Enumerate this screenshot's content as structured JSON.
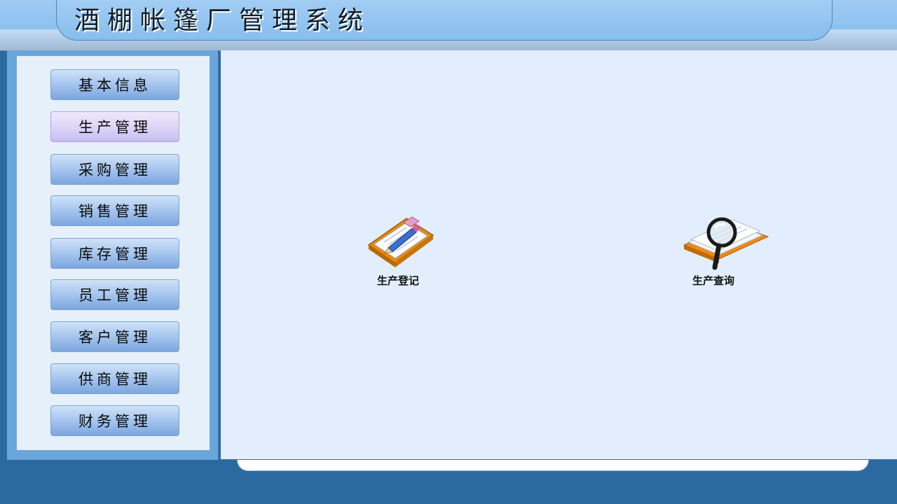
{
  "app": {
    "title": "酒棚帐篷厂管理系统"
  },
  "sidebar": {
    "active_index": 1,
    "items": [
      {
        "label": "基本信息"
      },
      {
        "label": "生产管理"
      },
      {
        "label": "采购管理"
      },
      {
        "label": "销售管理"
      },
      {
        "label": "库存管理"
      },
      {
        "label": "员工管理"
      },
      {
        "label": "客户管理"
      },
      {
        "label": "供商管理"
      },
      {
        "label": "财务管理"
      }
    ]
  },
  "main": {
    "features": [
      {
        "label": "生产登记",
        "icon": "clipboard-pen-icon"
      },
      {
        "label": "生产查询",
        "icon": "magnifier-document-icon"
      }
    ]
  },
  "colors": {
    "header_blue": "#8fc3f0",
    "sidebar_blue": "#6aa6da",
    "content_bg": "#e2eefd",
    "active_button": "#dcd4f6",
    "page_bg": "#2a6aa0"
  }
}
